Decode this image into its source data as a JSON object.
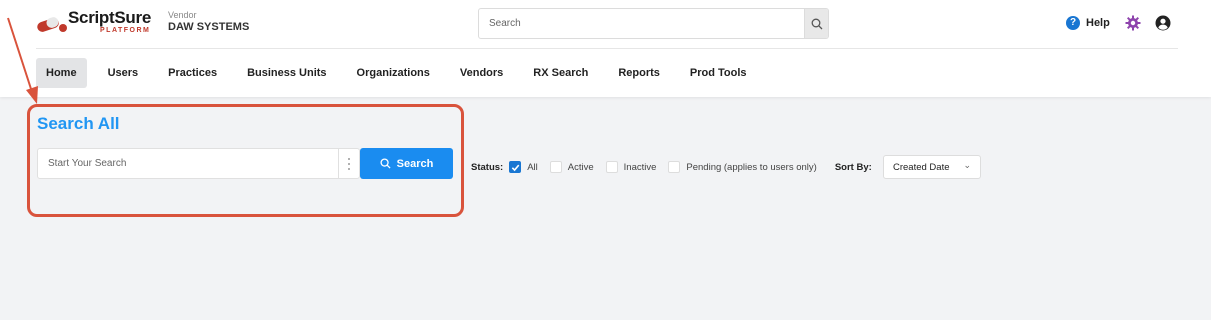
{
  "header": {
    "logo_text": "ScriptSure",
    "logo_sub": "PLATFORM",
    "vendor_label": "Vendor",
    "vendor_name": "DAW SYSTEMS",
    "search_placeholder": "Search",
    "help_label": "Help"
  },
  "nav": {
    "items": [
      {
        "label": "Home",
        "active": true
      },
      {
        "label": "Users"
      },
      {
        "label": "Practices"
      },
      {
        "label": "Business Units"
      },
      {
        "label": "Organizations"
      },
      {
        "label": "Vendors"
      },
      {
        "label": "RX Search"
      },
      {
        "label": "Reports"
      },
      {
        "label": "Prod Tools"
      }
    ]
  },
  "main": {
    "title": "Search All",
    "search_placeholder": "Start Your Search",
    "search_button": "Search",
    "status_label": "Status:",
    "status_options": [
      {
        "label": "All",
        "checked": true
      },
      {
        "label": "Active",
        "checked": false
      },
      {
        "label": "Inactive",
        "checked": false
      },
      {
        "label": "Pending (applies to users only)",
        "checked": false
      }
    ],
    "sort_label": "Sort By:",
    "sort_value": "Created Date"
  },
  "colors": {
    "accent": "#2196f3",
    "button": "#1a8cf0",
    "highlight": "#d9533c",
    "gear": "#8e44ad"
  }
}
